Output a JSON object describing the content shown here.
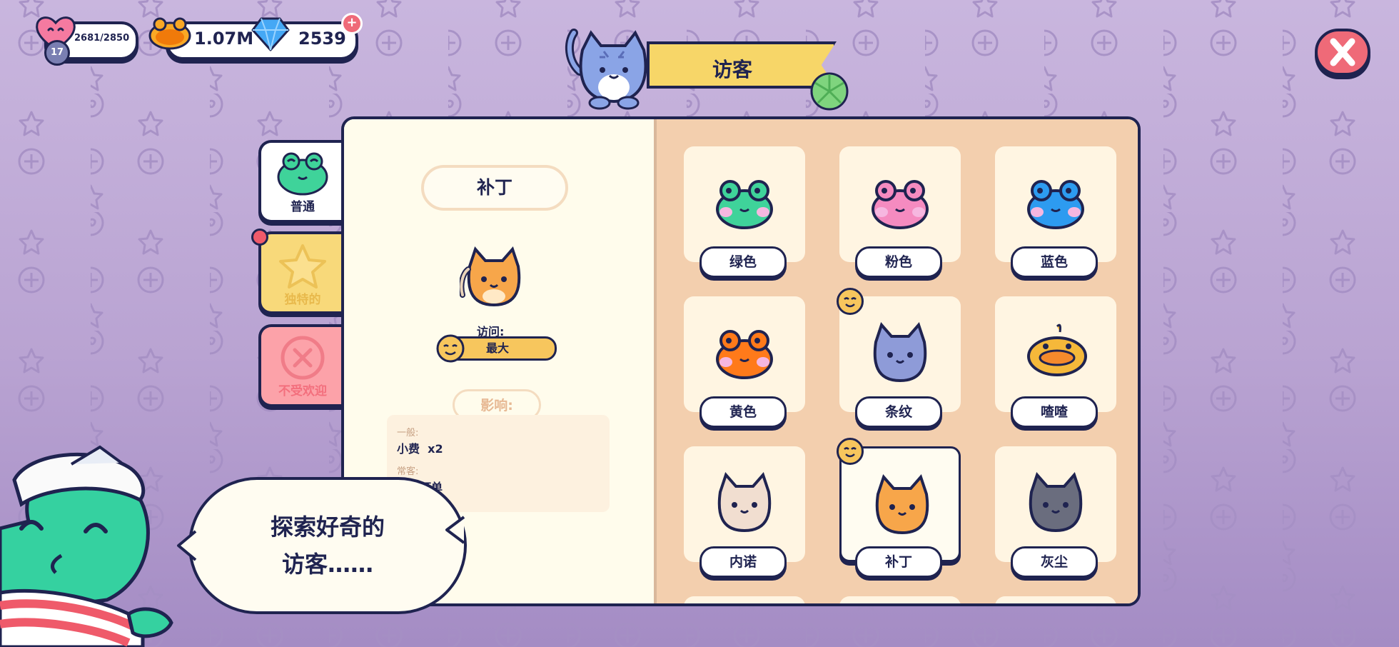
{
  "hud": {
    "level": "17",
    "hearts": "2681/2850",
    "coins": "1.07M",
    "gems": "2539"
  },
  "title_banner": {
    "label": "访客"
  },
  "tabs": [
    {
      "label": "普通",
      "active": true
    },
    {
      "label": "独特的",
      "active": false,
      "has_notification": true
    },
    {
      "label": "不受欢迎",
      "active": false
    }
  ],
  "detail": {
    "name": "补丁",
    "visits_label": "访问:",
    "visits_value": "最大",
    "effects_title": "影响:",
    "effects": [
      {
        "category": "一般:",
        "text": "小费  x2"
      },
      {
        "category": "常客:",
        "text": "连续订单"
      }
    ]
  },
  "visitors": [
    {
      "name": "绿色",
      "icon": "green-frog-icon",
      "color": "#3fd39a",
      "regular": false,
      "selected": false
    },
    {
      "name": "粉色",
      "icon": "pink-frog-icon",
      "color": "#f58bc0",
      "regular": false,
      "selected": false
    },
    {
      "name": "蓝色",
      "icon": "blue-frog-icon",
      "color": "#2d9bf0",
      "regular": false,
      "selected": false
    },
    {
      "name": "黄色",
      "icon": "orange-frog-icon",
      "color": "#ff7a1a",
      "regular": false,
      "selected": false
    },
    {
      "name": "条纹",
      "icon": "striped-cat-icon",
      "color": "#8e9bd8",
      "regular": true,
      "selected": false
    },
    {
      "name": "喳喳",
      "icon": "duck-icon",
      "color": "#f5b83a",
      "regular": false,
      "selected": false
    },
    {
      "name": "内诺",
      "icon": "siamese-cat-icon",
      "color": "#f1ded0",
      "regular": false,
      "selected": false
    },
    {
      "name": "补丁",
      "icon": "orange-cat-icon",
      "color": "#f7a64a",
      "regular": true,
      "selected": true
    },
    {
      "name": "灰尘",
      "icon": "gray-cat-icon",
      "color": "#6a6d7e",
      "regular": false,
      "selected": false
    }
  ],
  "speech": {
    "text_line1": "探索好奇的",
    "text_line2": "访客……"
  },
  "colors": {
    "ink": "#1f2350",
    "banner": "#f7d668",
    "close": "#ef6a78",
    "card": "#fff5e2",
    "right_page": "#f3cfae"
  }
}
